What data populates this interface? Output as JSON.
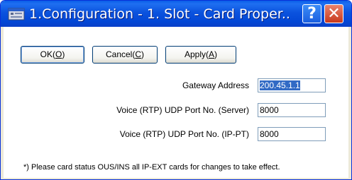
{
  "window": {
    "title": "1.Configuration - 1. Slot - Card Proper...",
    "help_glyph": "?",
    "close_glyph": "✕"
  },
  "buttons": {
    "ok": {
      "text": "OK(",
      "key": "O",
      "end": ")"
    },
    "cancel": {
      "text": "Cancel(",
      "key": "C",
      "end": ")"
    },
    "apply": {
      "text": "Apply(",
      "key": "A",
      "end": ")"
    }
  },
  "fields": [
    {
      "label": "Gateway Address",
      "value": "200.45.1.1",
      "selected": true
    },
    {
      "label": "Voice (RTP) UDP Port No. (Server)",
      "value": "8000",
      "selected": false
    },
    {
      "label": "Voice (RTP) UDP Port No. (IP-PT)",
      "value": "8000",
      "selected": false
    }
  ],
  "note": "*) Please card status OUS/INS all IP-EXT cards for changes to take effect.",
  "colors": {
    "titlebar": "#0b53de",
    "selection": "#316ac5",
    "close_button": "#c8391c"
  }
}
